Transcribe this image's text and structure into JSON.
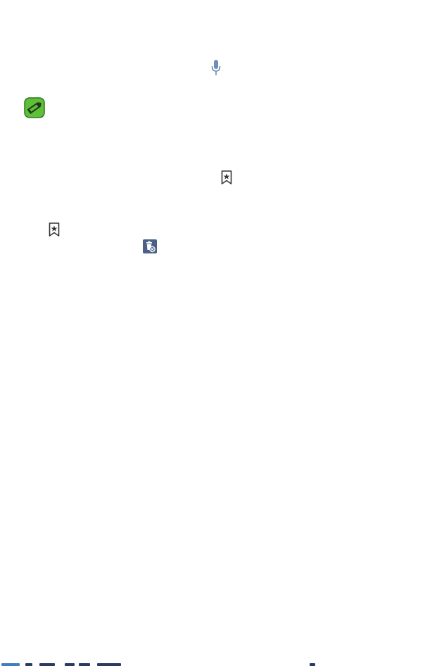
{
  "colors": {
    "mic_blue": "#6f8db6",
    "note_green": "#5fbf3a",
    "note_border": "#2b7a1a",
    "bookmark_dark": "#333333",
    "delete_bg": "#4a6088"
  },
  "icons": {
    "mic": "microphone-icon",
    "note": "note-pencil-icon",
    "bookmark": "bookmark-star-icon",
    "delete": "delete-bookmarks-icon"
  }
}
